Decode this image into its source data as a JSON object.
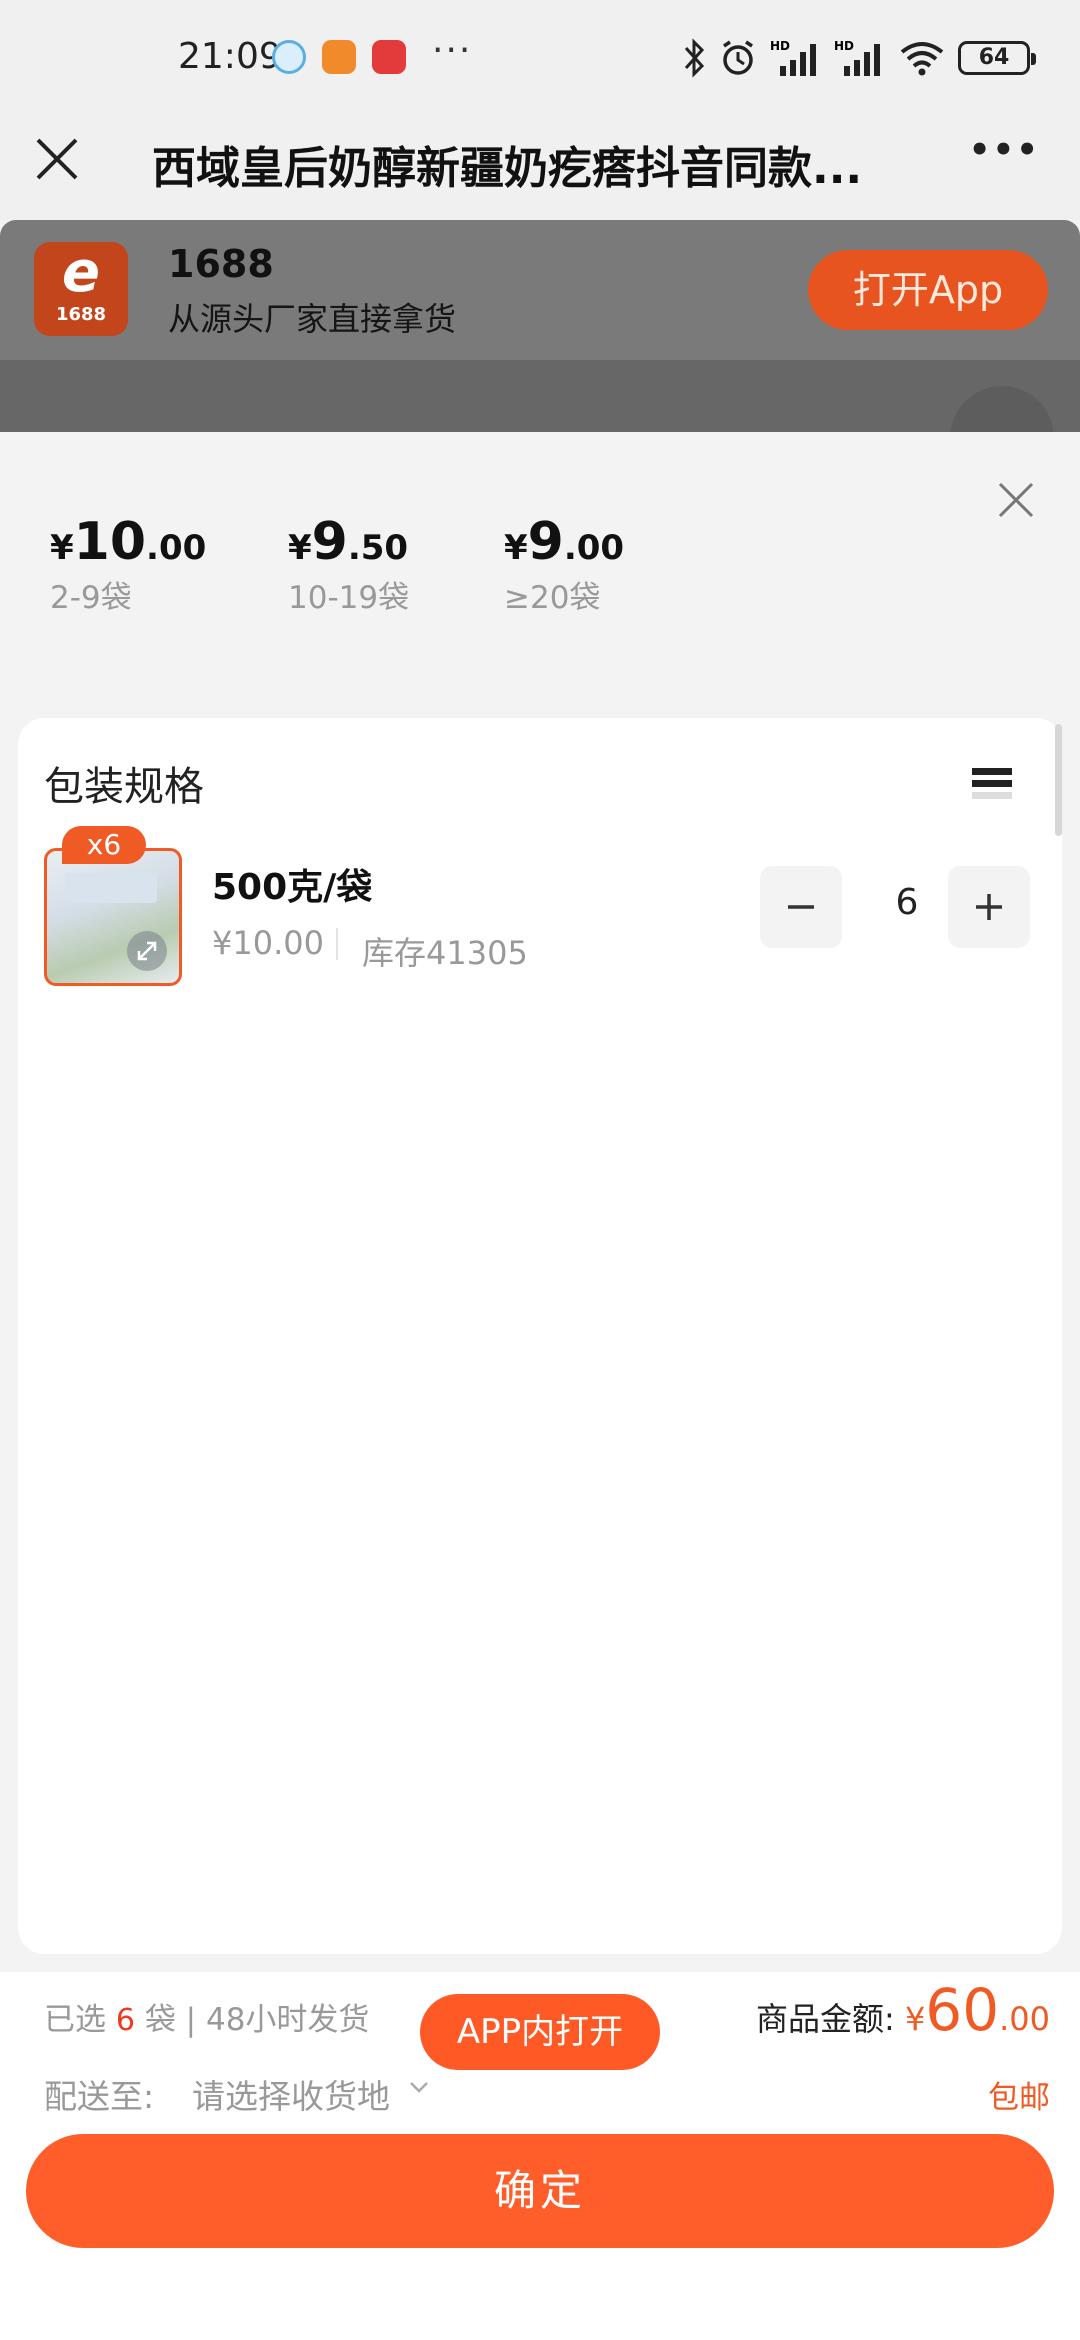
{
  "status_bar": {
    "time": "21:09",
    "battery": "64",
    "icons": [
      "kugou-icon",
      "app-icon",
      "red-envelope-icon",
      "bluetooth-icon",
      "alarm-icon",
      "signal-icon",
      "signal-icon",
      "wifi-icon"
    ]
  },
  "titlebar": {
    "title": "西域皇后奶醇新疆奶疙瘩抖音同款...",
    "more": "•••"
  },
  "banner": {
    "logo_text": "1688",
    "name": "1688",
    "subtitle": "从源头厂家直接拿货",
    "open_app": "打开App"
  },
  "price_tiers": [
    {
      "yen": "¥",
      "int": "10",
      "dec": ".00",
      "range": "2-9袋"
    },
    {
      "yen": "¥",
      "int": "9",
      "dec": ".50",
      "range": "10-19袋"
    },
    {
      "yen": "¥",
      "int": "9",
      "dec": ".00",
      "range": "≥20袋"
    }
  ],
  "spec": {
    "title": "包装规格",
    "item": {
      "badge": "x6",
      "name": "500克/袋",
      "price": "¥10.00",
      "stock": "库存41305",
      "quantity": "6"
    }
  },
  "bottom": {
    "selected_prefix": "已选",
    "selected_count": "6",
    "selected_suffix": "袋 | 48小时发货",
    "app_open": "APP内打开",
    "amount_label": "商品金额:",
    "amount_yen": "¥",
    "amount_int": "60",
    "amount_dec": ".00",
    "ship_label": "配送至:",
    "ship_value": "请选择收货地",
    "free_shipping": "包邮",
    "confirm": "确定"
  },
  "colors": {
    "accent": "#ff5e2b",
    "price_red": "#ef3a1f"
  }
}
